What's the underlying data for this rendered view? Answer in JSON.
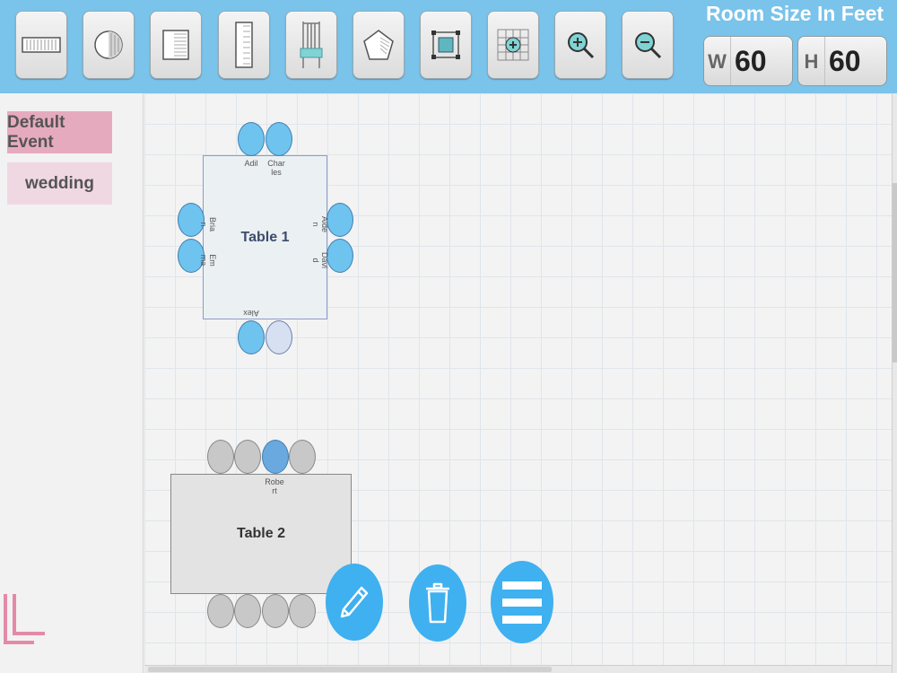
{
  "toolbar": {
    "tools": [
      {
        "name": "rect-table-tool",
        "icon": "long-table-icon"
      },
      {
        "name": "round-table-tool",
        "icon": "round-table-icon"
      },
      {
        "name": "square-table-tool",
        "icon": "square-table-icon"
      },
      {
        "name": "narrow-table-tool",
        "icon": "narrow-table-icon"
      },
      {
        "name": "chair-tool",
        "icon": "chair-icon"
      },
      {
        "name": "pentagon-tool",
        "icon": "pentagon-icon"
      },
      {
        "name": "select-area-tool",
        "icon": "select-area-icon"
      },
      {
        "name": "grid-add-tool",
        "icon": "grid-add-icon"
      },
      {
        "name": "zoom-in-button",
        "icon": "zoom-in-icon"
      },
      {
        "name": "zoom-out-button",
        "icon": "zoom-out-icon"
      }
    ],
    "room_size_title": "Room Size In Feet",
    "width_label": "W",
    "width_value": "60",
    "height_label": "H",
    "height_value": "60"
  },
  "sidebar": {
    "events": [
      {
        "label": "Default Event",
        "selected": true
      },
      {
        "label": "wedding",
        "selected": false
      }
    ],
    "collapse_icon": "corner-collapse-icon"
  },
  "tables": [
    {
      "name": "Table 1",
      "shape": "square",
      "guests": {
        "top": [
          "Adil",
          "Charles"
        ],
        "left": [
          "Brian",
          "Emma"
        ],
        "right": [
          "Aiden",
          "David"
        ],
        "bottom": [
          "Alex",
          ""
        ]
      }
    },
    {
      "name": "Table 2",
      "shape": "rectangle",
      "guests": {
        "top": [
          "",
          "",
          "Robert",
          ""
        ],
        "bottom": [
          "",
          "",
          "",
          ""
        ]
      }
    }
  ],
  "labels": {
    "adil": "Adil",
    "charles": "Char les",
    "brian": "Bria n",
    "emma": "Em ma",
    "aiden": "Aide n",
    "david": "Davi d",
    "alex": "Alex",
    "robert": "Robe rt"
  },
  "actions": {
    "edit_icon": "pencil-icon",
    "delete_icon": "trash-icon",
    "menu_icon": "hamburger-menu-icon"
  },
  "colors": {
    "toolbar": "#7ac3ea",
    "seat_assigned": "#6fc3ef",
    "seat_empty": "#c8c8c8",
    "fab": "#3fb0f0",
    "event_selected": "#e6aabf"
  }
}
